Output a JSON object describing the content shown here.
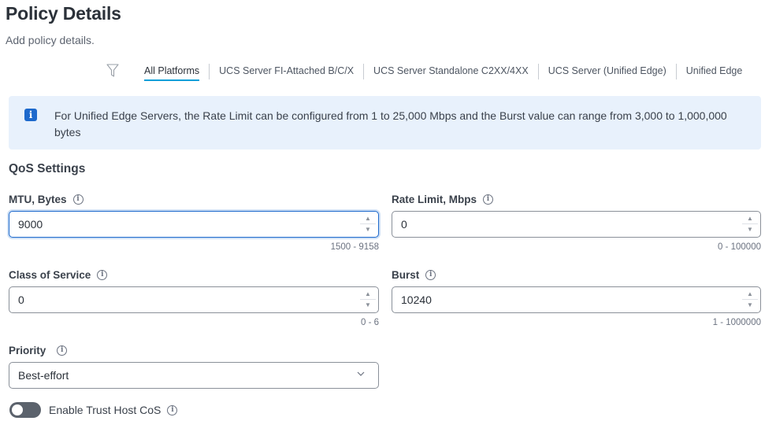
{
  "header": {
    "title": "Policy Details",
    "subtitle": "Add policy details."
  },
  "platforms": {
    "tabs": [
      "All Platforms",
      "UCS Server FI-Attached B/C/X",
      "UCS Server Standalone C2XX/4XX",
      "UCS Server (Unified Edge)",
      "Unified Edge"
    ],
    "active_index": 0
  },
  "banner": {
    "icon": "info-icon",
    "text": "For Unified Edge Servers, the Rate Limit can be configured from 1 to 25,000 Mbps and the Burst value can range from 3,000 to 1,000,000 bytes"
  },
  "qos": {
    "title": "QoS Settings",
    "mtu": {
      "label": "MTU, Bytes",
      "value": "9000",
      "range": "1500 - 9158"
    },
    "rate_limit": {
      "label": "Rate Limit, Mbps",
      "value": "0",
      "range": "0 - 100000"
    },
    "class_of_service": {
      "label": "Class of Service",
      "value": "0",
      "range": "0 - 6"
    },
    "burst": {
      "label": "Burst",
      "value": "10240",
      "range": "1 - 1000000"
    },
    "priority": {
      "label": "Priority",
      "value": "Best-effort"
    },
    "trust_host_cos": {
      "label": "Enable Trust Host CoS",
      "enabled": false
    }
  },
  "colors": {
    "accent": "#049fd9",
    "focus": "#1d69cc",
    "banner_bg": "#e8f1fc"
  }
}
